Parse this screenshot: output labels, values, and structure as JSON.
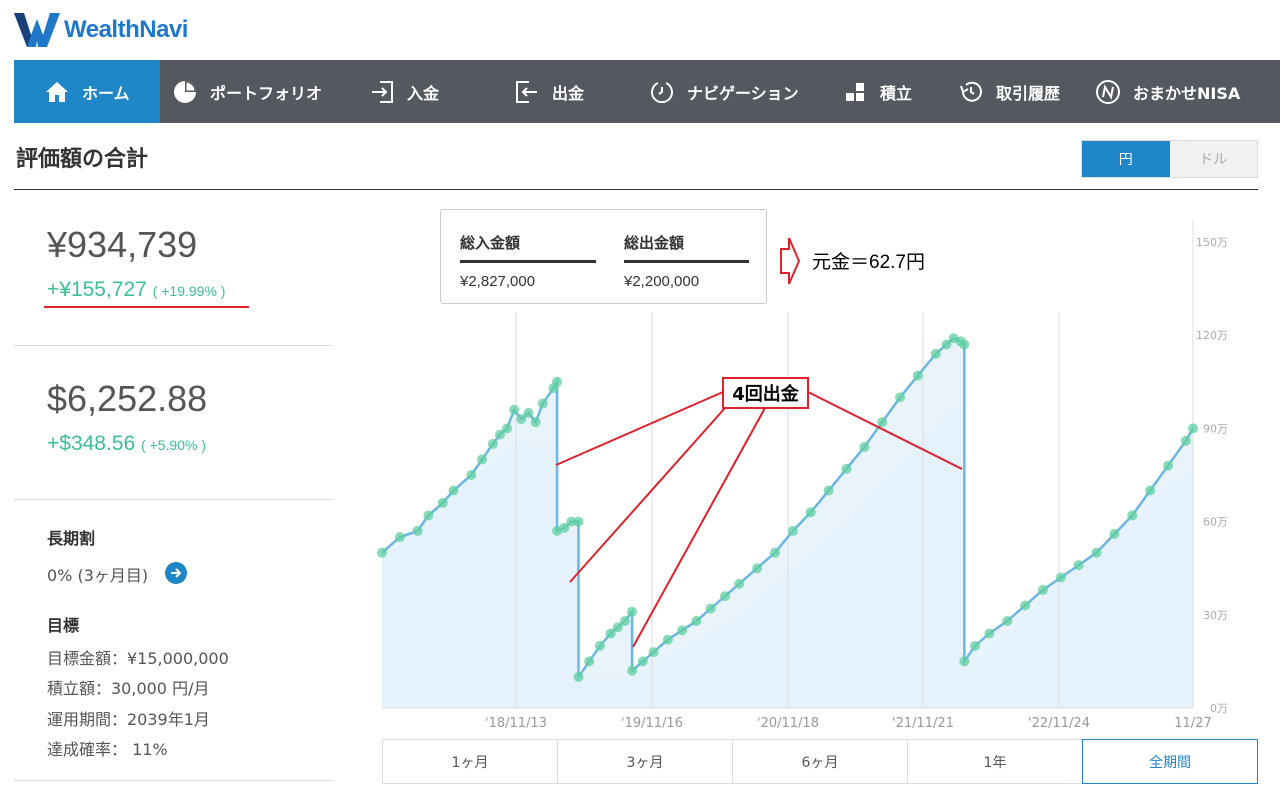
{
  "header": {
    "logo_text": "WealthNavi"
  },
  "nav": {
    "items": [
      {
        "label": "ホーム",
        "icon": "home-icon",
        "active": true
      },
      {
        "label": "ポートフォリオ",
        "icon": "pie-chart-icon",
        "active": false
      },
      {
        "label": "入金",
        "icon": "deposit-icon",
        "active": false
      },
      {
        "label": "出金",
        "icon": "withdraw-icon",
        "active": false
      },
      {
        "label": "ナビゲーション",
        "icon": "navigation-icon",
        "active": false
      },
      {
        "label": "積立",
        "icon": "blocks-icon",
        "active": false
      },
      {
        "label": "取引履歴",
        "icon": "history-icon",
        "active": false
      },
      {
        "label": "おまかせNISA",
        "icon": "nisa-icon",
        "active": false
      }
    ]
  },
  "page_title": "評価額の合計",
  "currency_toggle": {
    "yen": "円",
    "dollar": "ドル",
    "selected": "円"
  },
  "valuation": {
    "yen_total": "¥934,739",
    "yen_gain": "+¥155,727",
    "yen_gain_pct": "( +19.99% )",
    "usd_total": "$6,252.88",
    "usd_gain": "+$348.56",
    "usd_gain_pct": "( +5.90% )"
  },
  "long_term": {
    "heading": "長期割",
    "value": "0% (3ヶ月目)"
  },
  "goal": {
    "heading": "目標",
    "target_amount": "目標金額：¥15,000,000",
    "monthly": "積立額：30,000 円/月",
    "period": "運用期間：2039年1月",
    "probability": "達成確率： 11%"
  },
  "summary": {
    "deposit_label": "総入金額",
    "deposit_value": "¥2,827,000",
    "withdraw_label": "総出金額",
    "withdraw_value": "¥2,200,000"
  },
  "annotations": {
    "principal": "元金＝62.7円",
    "withdrawals": "4回出金"
  },
  "periods": [
    "1ヶ月",
    "3ヶ月",
    "6ヶ月",
    "1年",
    "全期間"
  ],
  "period_selected": "全期間",
  "colors": {
    "accent": "#1f86c8",
    "gain": "#3cbf94",
    "nav_bg": "#54595f",
    "annotation": "#e0202a",
    "area": "#e4f1fa",
    "line": "#6cb6e4"
  },
  "chart_data": {
    "type": "area",
    "x_ticks": [
      "'18/11/13",
      "'19/11/16",
      "'20/11/18",
      "'21/11/21",
      "'22/11/24",
      "11/27"
    ],
    "y_ticks": [
      "0万",
      "30万",
      "60万",
      "90万",
      "120万",
      "150万"
    ],
    "ylim": [
      0,
      150
    ],
    "unit": "万円",
    "series": [
      {
        "name": "",
        "points": [
          [
            0,
            50
          ],
          [
            5,
            55
          ],
          [
            10,
            57
          ],
          [
            13,
            62
          ],
          [
            17,
            66
          ],
          [
            20,
            70
          ],
          [
            25,
            75
          ],
          [
            28,
            80
          ],
          [
            31,
            85
          ],
          [
            33,
            88
          ],
          [
            35,
            90
          ],
          [
            37,
            96
          ],
          [
            39,
            93
          ],
          [
            41,
            95
          ],
          [
            43,
            92
          ],
          [
            45,
            98
          ],
          [
            48,
            103
          ],
          [
            49,
            105
          ],
          [
            49,
            57
          ],
          [
            51,
            58
          ],
          [
            53,
            60
          ],
          [
            55,
            60
          ],
          [
            55,
            10
          ],
          [
            58,
            15
          ],
          [
            61,
            20
          ],
          [
            64,
            24
          ],
          [
            66,
            26
          ],
          [
            68,
            28
          ],
          [
            70,
            31
          ],
          [
            70,
            12
          ],
          [
            73,
            15
          ],
          [
            76,
            18
          ],
          [
            80,
            22
          ],
          [
            84,
            25
          ],
          [
            88,
            28
          ],
          [
            92,
            32
          ],
          [
            96,
            36
          ],
          [
            100,
            40
          ],
          [
            105,
            45
          ],
          [
            110,
            50
          ],
          [
            115,
            57
          ],
          [
            120,
            63
          ],
          [
            125,
            70
          ],
          [
            130,
            77
          ],
          [
            135,
            84
          ],
          [
            140,
            92
          ],
          [
            145,
            100
          ],
          [
            150,
            107
          ],
          [
            155,
            114
          ],
          [
            158,
            117
          ],
          [
            160,
            119
          ],
          [
            162,
            118
          ],
          [
            163,
            117
          ],
          [
            163,
            15
          ],
          [
            166,
            20
          ],
          [
            170,
            24
          ],
          [
            175,
            28
          ],
          [
            180,
            33
          ],
          [
            185,
            38
          ],
          [
            190,
            42
          ],
          [
            195,
            46
          ],
          [
            200,
            50
          ],
          [
            205,
            56
          ],
          [
            210,
            62
          ],
          [
            215,
            70
          ],
          [
            220,
            78
          ],
          [
            225,
            86
          ],
          [
            227,
            90
          ]
        ]
      },
      {
        "name": "",
        "points": [
          [
            0,
            50
          ],
          [
            37,
            85
          ],
          [
            49,
            85
          ],
          [
            49,
            57
          ],
          [
            55,
            57
          ],
          [
            55,
            10
          ],
          [
            70,
            10
          ],
          [
            100,
            30
          ],
          [
            130,
            60
          ],
          [
            160,
            97
          ],
          [
            163,
            97
          ],
          [
            163,
            12
          ],
          [
            195,
            46
          ],
          [
            227,
            78
          ]
        ]
      }
    ]
  }
}
